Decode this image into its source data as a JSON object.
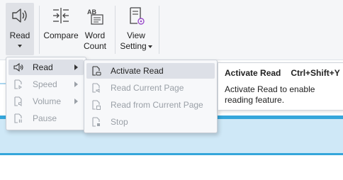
{
  "ribbon": {
    "read_label": "Read",
    "compare_label": "Compare",
    "word_count_label_1": "Word",
    "word_count_label_2": "Count",
    "view_setting_label_1": "View",
    "view_setting_label_2": "Setting"
  },
  "read_menu": {
    "items": [
      {
        "label": "Read",
        "icon": "speaker-icon"
      },
      {
        "label": "Speed",
        "icon": "speed-icon"
      },
      {
        "label": "Volume",
        "icon": "volume-icon"
      },
      {
        "label": "Pause",
        "icon": "pause-icon"
      }
    ]
  },
  "read_submenu": {
    "items": [
      {
        "label": "Activate Read",
        "icon": "activate-read-icon"
      },
      {
        "label": "Read Current Page",
        "icon": "read-page-icon"
      },
      {
        "label": "Read from Current Page",
        "icon": "read-from-page-icon"
      },
      {
        "label": "Stop",
        "icon": "stop-icon"
      }
    ]
  },
  "tooltip": {
    "title": "Activate Read",
    "shortcut": "Ctrl+Shift+Y",
    "description": "Activate Read to enable reading feature."
  },
  "colors": {
    "accent": "#35a6db",
    "band": "#cfe8f7",
    "highlight": "#dde0e7"
  }
}
